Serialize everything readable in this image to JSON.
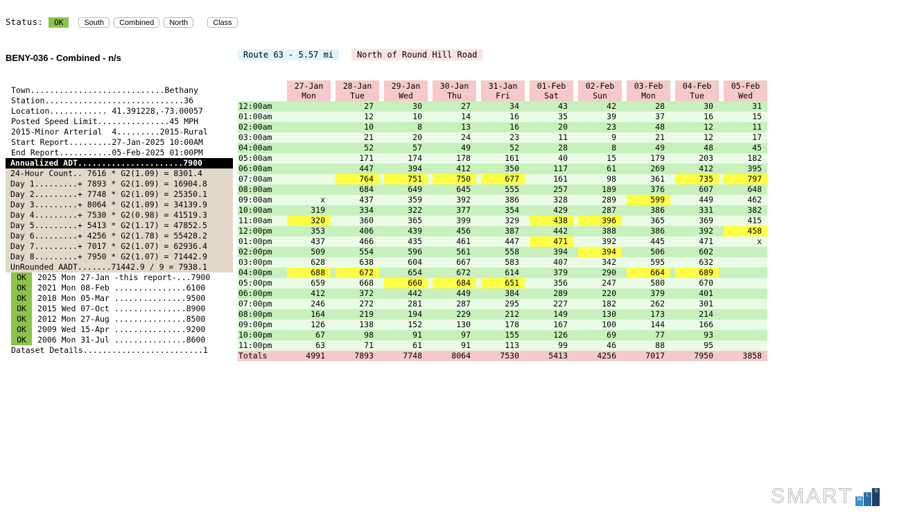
{
  "status": {
    "label": "Status:",
    "value": "OK",
    "buttons": [
      "South",
      "Combined",
      "North",
      "Class"
    ]
  },
  "title": "BENY-036 - Combined  - n/s",
  "route_tag": "Route 63 - 5.57 mi",
  "road_tag": "North of Round Hill Road",
  "info": {
    "plain": [
      "Town............................Bethany",
      "Station.............................36",
      "Location............ 41.391228,-73.00057",
      "Posted Speed Limit...............45 MPH",
      "2015-Minor Arterial  4.........2015-Rural",
      "Start Report.........27-Jan-2025 10:00AM",
      "End Report...........05-Feb-2025 01:00PM"
    ],
    "header": "Annualized ADT......................7900",
    "calc": [
      "24-Hour Count.. 7616 * G2(1.09) = 8301.4",
      "Day 1.........+ 7893 * G2(1.09) = 16904.8",
      "Day 2.........+ 7748 * G2(1.09) = 25350.1",
      "Day 3.........+ 8064 * G2(1.09) = 34139.9",
      "Day 4.........+ 7530 * G2(0.98) = 41519.3",
      "Day 5.........+ 5413 * G2(1.17) = 47852.5",
      "Day 6.........+ 4256 * G2(1.78) = 55428.2",
      "Day 7.........+ 7017 * G2(1.07) = 62936.4",
      "Day 8.........+ 7950 * G2(1.07) = 71442.9",
      "UnRounded AADT.......71442.9 / 9 = 7938.1"
    ],
    "history": [
      {
        "ok": "OK",
        "text": "2025 Mon 27-Jan -this report-...7900"
      },
      {
        "ok": "OK",
        "text": "2021 Mon 08-Feb ...............6100"
      },
      {
        "ok": "OK",
        "text": "2018 Mon 05-Mar ...............9500"
      },
      {
        "ok": "OK",
        "text": "2015 Wed 07-Oct ...............8900"
      },
      {
        "ok": "OK",
        "text": "2012 Mon 27-Aug ...............8500"
      },
      {
        "ok": "OK",
        "text": "2009 Wed 15-Apr ...............9200"
      },
      {
        "ok": "OK",
        "text": "2006 Mon 31-Jul ...............8600"
      }
    ],
    "dataset": "Dataset Details.........................1"
  },
  "table": {
    "headers": [
      {
        "date": "27-Jan",
        "day": "Mon"
      },
      {
        "date": "28-Jan",
        "day": "Tue"
      },
      {
        "date": "29-Jan",
        "day": "Wed"
      },
      {
        "date": "30-Jan",
        "day": "Thu"
      },
      {
        "date": "31-Jan",
        "day": "Fri"
      },
      {
        "date": "01-Feb",
        "day": "Sat"
      },
      {
        "date": "02-Feb",
        "day": "Sun"
      },
      {
        "date": "03-Feb",
        "day": "Mon"
      },
      {
        "date": "04-Feb",
        "day": "Tue"
      },
      {
        "date": "05-Feb",
        "day": "Wed"
      }
    ],
    "rows": [
      {
        "time": "12:00am",
        "values": [
          "",
          "27",
          "30",
          "27",
          "34",
          "43",
          "42",
          "28",
          "30",
          "31"
        ]
      },
      {
        "time": "01:00am",
        "values": [
          "",
          "12",
          "10",
          "14",
          "16",
          "35",
          "39",
          "37",
          "16",
          "15"
        ]
      },
      {
        "time": "02:00am",
        "values": [
          "",
          "10",
          "8",
          "13",
          "16",
          "20",
          "23",
          "48",
          "12",
          "11"
        ]
      },
      {
        "time": "03:00am",
        "values": [
          "",
          "21",
          "20",
          "24",
          "23",
          "11",
          "9",
          "21",
          "12",
          "17"
        ]
      },
      {
        "time": "04:00am",
        "values": [
          "",
          "52",
          "57",
          "49",
          "52",
          "28",
          "8",
          "49",
          "48",
          "45"
        ]
      },
      {
        "time": "05:00am",
        "values": [
          "",
          "171",
          "174",
          "178",
          "161",
          "40",
          "15",
          "179",
          "203",
          "182"
        ]
      },
      {
        "time": "06:00am",
        "values": [
          "",
          "447",
          "394",
          "412",
          "350",
          "117",
          "61",
          "269",
          "412",
          "395"
        ]
      },
      {
        "time": "07:00am",
        "values": [
          "",
          "764",
          "751",
          "750",
          "677",
          "161",
          "98",
          "361",
          "735",
          "797"
        ]
      },
      {
        "time": "08:00am",
        "values": [
          "",
          "684",
          "649",
          "645",
          "555",
          "257",
          "189",
          "376",
          "607",
          "648"
        ]
      },
      {
        "time": "09:00am",
        "values": [
          "x",
          "437",
          "359",
          "392",
          "386",
          "328",
          "289",
          "599",
          "449",
          "462"
        ]
      },
      {
        "time": "10:00am",
        "values": [
          "319",
          "334",
          "322",
          "377",
          "354",
          "429",
          "287",
          "386",
          "331",
          "382"
        ]
      },
      {
        "time": "11:00am",
        "values": [
          "320",
          "360",
          "365",
          "399",
          "329",
          "438",
          "396",
          "365",
          "369",
          "415"
        ]
      },
      {
        "time": "12:00pm",
        "values": [
          "353",
          "406",
          "439",
          "456",
          "387",
          "442",
          "388",
          "386",
          "392",
          "458"
        ]
      },
      {
        "time": "01:00pm",
        "values": [
          "437",
          "466",
          "435",
          "461",
          "447",
          "471",
          "392",
          "445",
          "471",
          "x"
        ]
      },
      {
        "time": "02:00pm",
        "values": [
          "509",
          "554",
          "596",
          "561",
          "558",
          "394",
          "394",
          "506",
          "602",
          ""
        ]
      },
      {
        "time": "03:00pm",
        "values": [
          "628",
          "638",
          "604",
          "667",
          "583",
          "407",
          "342",
          "595",
          "632",
          ""
        ]
      },
      {
        "time": "04:00pm",
        "values": [
          "688",
          "672",
          "654",
          "672",
          "614",
          "379",
          "290",
          "664",
          "689",
          ""
        ]
      },
      {
        "time": "05:00pm",
        "values": [
          "659",
          "668",
          "660",
          "684",
          "651",
          "356",
          "247",
          "580",
          "670",
          ""
        ]
      },
      {
        "time": "06:00pm",
        "values": [
          "412",
          "372",
          "442",
          "449",
          "384",
          "289",
          "220",
          "379",
          "401",
          ""
        ]
      },
      {
        "time": "07:00pm",
        "values": [
          "246",
          "272",
          "281",
          "287",
          "295",
          "227",
          "182",
          "262",
          "301",
          ""
        ]
      },
      {
        "time": "08:00pm",
        "values": [
          "164",
          "219",
          "194",
          "229",
          "212",
          "149",
          "130",
          "173",
          "214",
          ""
        ]
      },
      {
        "time": "09:00pm",
        "values": [
          "126",
          "138",
          "152",
          "130",
          "178",
          "167",
          "100",
          "144",
          "166",
          ""
        ]
      },
      {
        "time": "10:00pm",
        "values": [
          "67",
          "98",
          "91",
          "97",
          "155",
          "126",
          "69",
          "77",
          "93",
          ""
        ]
      },
      {
        "time": "11:00pm",
        "values": [
          "63",
          "71",
          "61",
          "91",
          "113",
          "99",
          "46",
          "88",
          "95",
          ""
        ]
      }
    ],
    "totals_label": "Totals",
    "totals": [
      "4991",
      "7893",
      "7748",
      "8064",
      "7530",
      "5413",
      "4256",
      "7017",
      "7950",
      "3858"
    ],
    "highlights": [
      [
        7,
        1
      ],
      [
        7,
        2
      ],
      [
        7,
        3
      ],
      [
        7,
        4
      ],
      [
        7,
        8
      ],
      [
        7,
        9
      ],
      [
        9,
        7
      ],
      [
        11,
        0
      ],
      [
        11,
        5
      ],
      [
        11,
        6
      ],
      [
        12,
        9
      ],
      [
        13,
        5
      ],
      [
        14,
        6
      ],
      [
        16,
        0
      ],
      [
        16,
        1
      ],
      [
        16,
        7
      ],
      [
        16,
        8
      ],
      [
        17,
        2
      ],
      [
        17,
        3
      ],
      [
        17,
        4
      ]
    ],
    "highlight_color": "#ffff44"
  },
  "logo": {
    "word": "SMART",
    "blocks": [
      {
        "letter": "M",
        "color": "#3f8fd0"
      },
      {
        "letter": "L",
        "color": "#2a6ea8"
      },
      {
        "letter": "S",
        "color": "#1f3f63"
      }
    ]
  }
}
